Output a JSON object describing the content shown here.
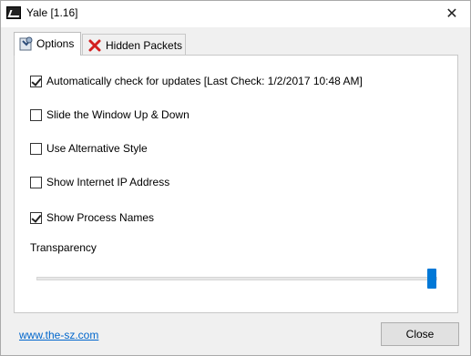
{
  "window": {
    "title": "Yale [1.16]",
    "close_glyph": "✕"
  },
  "tabs": [
    {
      "label": "Options",
      "icon": "options-icon",
      "active": true
    },
    {
      "label": "Hidden Packets",
      "icon": "red-x-icon",
      "active": false
    }
  ],
  "options": [
    {
      "label": "Automatically check for updates [Last Check: 1/2/2017 10:48 AM]",
      "checked": true
    },
    {
      "label": "Slide the Window Up & Down",
      "checked": false
    },
    {
      "label": "Use Alternative Style",
      "checked": false
    },
    {
      "label": "Show Internet IP Address",
      "checked": false
    },
    {
      "label": "Show Process Names",
      "checked": true
    }
  ],
  "transparency": {
    "label": "Transparency",
    "value_fraction": 1.0
  },
  "footer": {
    "link_text": "www.the-sz.com",
    "close_label": "Close"
  },
  "colors": {
    "accent": "#0078d7",
    "link": "#0066cc"
  }
}
